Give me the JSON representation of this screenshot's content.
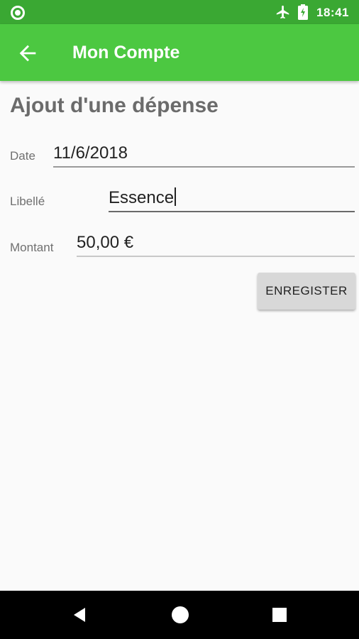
{
  "status_bar": {
    "time": "18:41",
    "icons": [
      "circle-notification-icon",
      "airplane-icon",
      "battery-charging-icon"
    ]
  },
  "app_bar": {
    "title": "Mon Compte",
    "back_icon": "arrow-back-icon"
  },
  "page": {
    "title": "Ajout d'une dépense"
  },
  "form": {
    "date": {
      "label": "Date",
      "value": "11/6/2018"
    },
    "libelle": {
      "label": "Libellé",
      "value": "Essence"
    },
    "montant": {
      "label": "Montant",
      "value": "50,00 €"
    },
    "save_label": "ENREGISTER"
  },
  "nav_bar": {
    "icons": [
      "back-triangle-icon",
      "home-circle-icon",
      "recents-square-icon"
    ]
  },
  "colors": {
    "status_bar": "#3aa833",
    "app_bar": "#4cc841",
    "background": "#fafafa"
  }
}
